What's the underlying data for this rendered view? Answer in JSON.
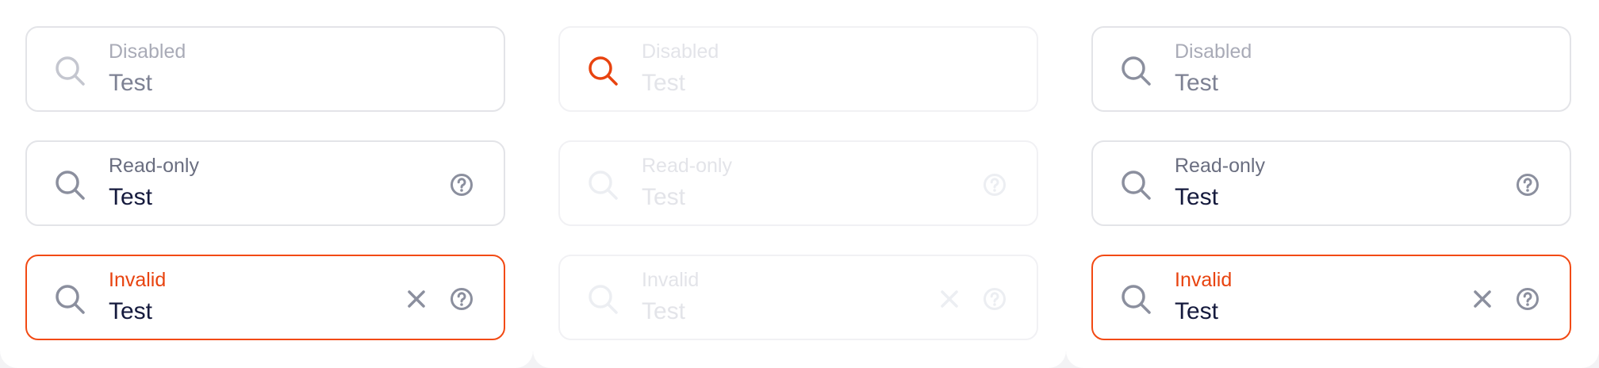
{
  "colors": {
    "icon_gray": "#8b8f9e",
    "icon_light": "#c4c6cf",
    "icon_faded": "#eceef2",
    "accent_invalid": "#f24a14",
    "icon_orange": "#e8430f"
  },
  "panels": [
    {
      "fields": [
        {
          "label": "Disabled",
          "value": "Test",
          "icon": "search-icon"
        },
        {
          "label": "Read-only",
          "value": "Test",
          "icon": "search-icon",
          "help": "help-icon"
        },
        {
          "label": "Invalid",
          "value": "Test",
          "icon": "search-icon",
          "clear": "close-icon",
          "help": "help-icon"
        }
      ]
    },
    {
      "fields": [
        {
          "label": "Disabled",
          "value": "Test",
          "icon": "search-icon"
        },
        {
          "label": "Read-only",
          "value": "Test",
          "icon": "search-icon",
          "help": "help-icon"
        },
        {
          "label": "Invalid",
          "value": "Test",
          "icon": "search-icon",
          "clear": "close-icon",
          "help": "help-icon"
        }
      ]
    },
    {
      "fields": [
        {
          "label": "Disabled",
          "value": "Test",
          "icon": "search-icon"
        },
        {
          "label": "Read-only",
          "value": "Test",
          "icon": "search-icon",
          "help": "help-icon"
        },
        {
          "label": "Invalid",
          "value": "Test",
          "icon": "search-icon",
          "clear": "close-icon",
          "help": "help-icon"
        }
      ]
    }
  ]
}
